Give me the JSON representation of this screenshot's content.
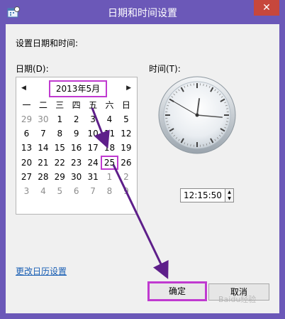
{
  "window": {
    "title": "日期和时间设置",
    "close_glyph": "✕"
  },
  "section_label": "设置日期和时间:",
  "date_label": "日期(D):",
  "time_label": "时间(T):",
  "calendar": {
    "month_label": "2013年5月",
    "prev_glyph": "◀",
    "next_glyph": "▶",
    "weekdays": [
      "一",
      "二",
      "三",
      "四",
      "五",
      "六",
      "日"
    ],
    "weeks": [
      [
        "29",
        "30",
        "1",
        "2",
        "3",
        "4",
        "5"
      ],
      [
        "6",
        "7",
        "8",
        "9",
        "10",
        "11",
        "12"
      ],
      [
        "13",
        "14",
        "15",
        "16",
        "17",
        "18",
        "19"
      ],
      [
        "20",
        "21",
        "22",
        "23",
        "24",
        "25",
        "26"
      ],
      [
        "27",
        "28",
        "29",
        "30",
        "31",
        "1",
        "2"
      ],
      [
        "3",
        "4",
        "5",
        "6",
        "7",
        "8",
        "9"
      ]
    ],
    "selected_day": "25"
  },
  "clock": {
    "hour": 12,
    "minute": 15,
    "second": 50
  },
  "time_value": "12:15:50",
  "change_calendar_link": "更改日历设置",
  "buttons": {
    "ok": "确定",
    "cancel": "取消"
  },
  "watermark": "Baidu经验",
  "colors": {
    "frame": "#6b58b8",
    "highlight": "#c03ad0",
    "close": "#c7473c"
  }
}
